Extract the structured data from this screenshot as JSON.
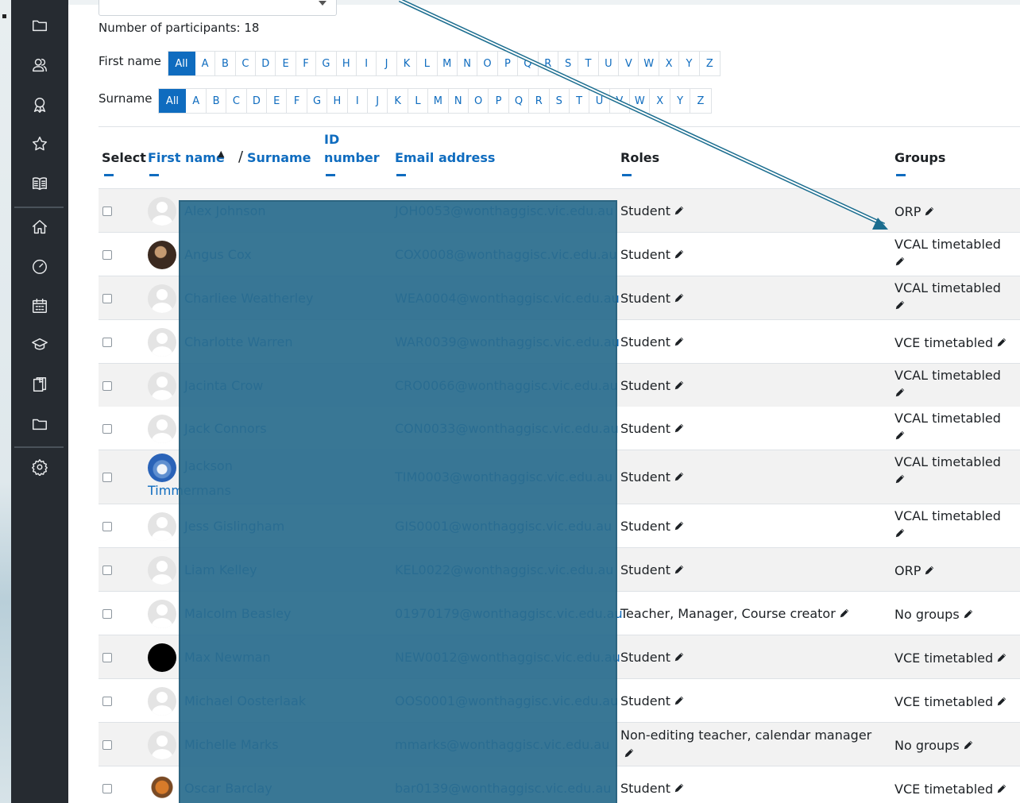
{
  "participants": {
    "count_text": "Number of participants: 18"
  },
  "filters": {
    "firstname_label": "First name",
    "surname_label": "Surname",
    "all_label": "All",
    "letters": [
      "A",
      "B",
      "C",
      "D",
      "E",
      "F",
      "G",
      "H",
      "I",
      "J",
      "K",
      "L",
      "M",
      "N",
      "O",
      "P",
      "Q",
      "R",
      "S",
      "T",
      "U",
      "V",
      "W",
      "X",
      "Y",
      "Z"
    ]
  },
  "table": {
    "headers": {
      "select": "Select",
      "first_name": "First name",
      "sort_indicator": "▲",
      "divider": "/",
      "surname": "Surname",
      "id_line1": "ID",
      "id_line2": "number",
      "email": "Email address",
      "roles": "Roles",
      "groups": "Groups"
    },
    "rows": [
      {
        "name": "Alex Johnson",
        "email": "JOH0053@wonthaggisc.vic.edu.au",
        "role": "Student",
        "group": "ORP",
        "avatar": "default"
      },
      {
        "name": "Angus Cox",
        "email": "COX0008@wonthaggisc.vic.edu.au",
        "role": "Student",
        "group": "VCAL timetabled",
        "avatar": "photo-cox"
      },
      {
        "name": "Charliee Weatherley",
        "email": "WEA0004@wonthaggisc.vic.edu.au",
        "role": "Student",
        "group": "VCAL timetabled",
        "avatar": "default"
      },
      {
        "name": "Charlotte Warren",
        "email": "WAR0039@wonthaggisc.vic.edu.au",
        "role": "Student",
        "group": "VCE timetabled",
        "avatar": "default"
      },
      {
        "name": "Jacinta Crow",
        "email": "CRO0066@wonthaggisc.vic.edu.au",
        "role": "Student",
        "group": "VCAL timetabled",
        "avatar": "default"
      },
      {
        "name": "Jack Connors",
        "email": "CON0033@wonthaggisc.vic.edu.au",
        "role": "Student",
        "group": "VCAL timetabled",
        "avatar": "default"
      },
      {
        "name_line1": "Jackson",
        "name_line2": "Timmermans",
        "email": "TIM0003@wonthaggisc.vic.edu.au",
        "role": "Student",
        "group": "VCAL timetabled",
        "avatar": "photo-jackson"
      },
      {
        "name": "Jess Gislingham",
        "email": "GIS0001@wonthaggisc.vic.edu.au",
        "role": "Student",
        "group": "VCAL timetabled",
        "avatar": "default"
      },
      {
        "name": "Liam Kelley",
        "email": "KEL0022@wonthaggisc.vic.edu.au",
        "role": "Student",
        "group": "ORP",
        "avatar": "default"
      },
      {
        "name": "Malcolm Beasley",
        "email": "01970179@wonthaggisc.vic.edu.au",
        "role": "Teacher, Manager, Course creator",
        "group": "No groups",
        "avatar": "default"
      },
      {
        "name": "Max Newman",
        "email": "NEW0012@wonthaggisc.vic.edu.au",
        "role": "Student",
        "group": "VCE timetabled",
        "avatar": "photo-max"
      },
      {
        "name": "Michael Oosterlaak",
        "email": "OOS0001@wonthaggisc.vic.edu.au",
        "role": "Student",
        "group": "VCE timetabled",
        "avatar": "default"
      },
      {
        "name": "Michelle Marks",
        "email": "mmarks@wonthaggisc.vic.edu.au",
        "role": "Non-editing teacher, calendar manager",
        "group": "No groups",
        "avatar": "default"
      },
      {
        "name": "Oscar Barclay",
        "email": "bar0139@wonthaggisc.vic.edu.au",
        "role": "Student",
        "group": "VCE timetabled",
        "avatar": "photo-oscar"
      }
    ]
  },
  "nav": {
    "icons": [
      "folder-icon",
      "participants-icon",
      "badges-icon",
      "competencies-icon",
      "grades-icon",
      "home-icon",
      "dashboard-icon",
      "calendar-icon",
      "courses-icon",
      "content-bank-icon",
      "private-files-icon",
      "site-admin-icon"
    ]
  },
  "colors": {
    "link": "#0f6cbf",
    "drawer": "#262b31",
    "redaction": "#2b6d8e",
    "annotation_arrow": "#1b6d8f"
  }
}
